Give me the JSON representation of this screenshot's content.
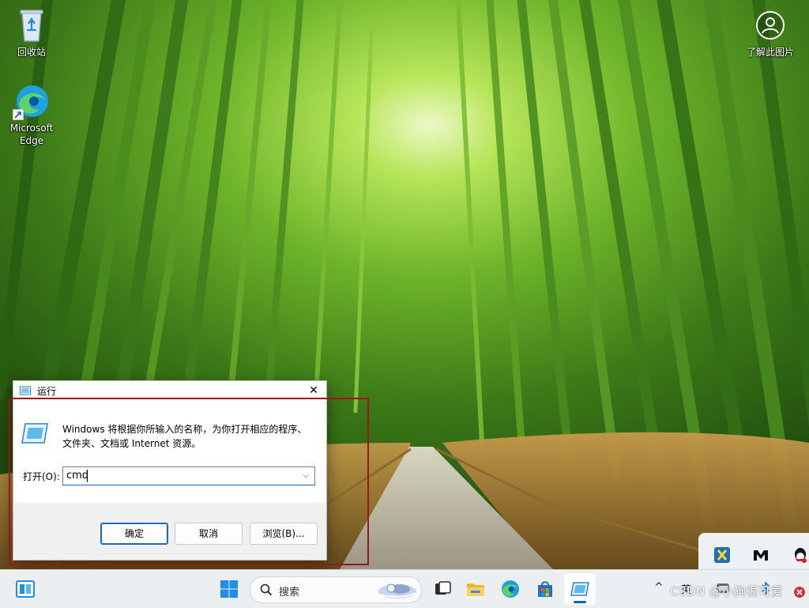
{
  "desktop": {
    "icons": [
      {
        "label": "回收站"
      },
      {
        "label_line1": "Microsoft",
        "label_line2": "Edge"
      },
      {
        "label": "了解此图片"
      }
    ]
  },
  "run_dialog": {
    "title": "运行",
    "close_glyph": "✕",
    "description": "Windows 将根据你所输入的名称，为你打开相应的程序、文件夹、文档或 Internet 资源。",
    "open_label": "打开(O):",
    "command_value": "cmd",
    "dropdown_glyph": "⌵",
    "buttons": {
      "ok": "确定",
      "cancel": "取消",
      "browse": "浏览(B)..."
    }
  },
  "taskbar": {
    "search_placeholder": "搜索",
    "tray_chevron": "^",
    "ime_indicator": "英",
    "apps": [
      "widgets",
      "start",
      "search",
      "task-view",
      "file-explorer",
      "edge",
      "store",
      "run"
    ]
  },
  "tray_popup": {
    "icons": [
      "xftp-icon",
      "mi-icon",
      "qq-icon"
    ]
  },
  "watermark": "CSDN @小狗很可爱",
  "colors": {
    "accent": "#0067c0",
    "annotation": "#a0151a",
    "taskbar_bg": "#eceff2"
  }
}
